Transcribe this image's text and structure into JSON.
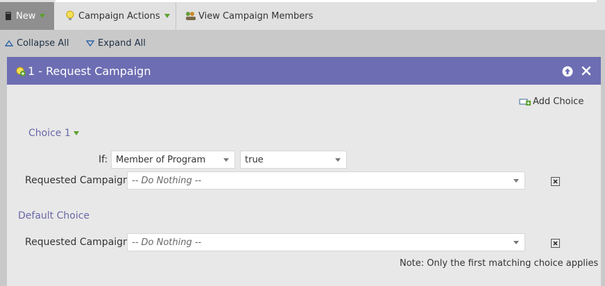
{
  "toolbar": {
    "new_label": "New",
    "campaign_actions_label": "Campaign Actions",
    "view_members_label": "View Campaign Members"
  },
  "subbar": {
    "collapse_all": "Collapse All",
    "expand_all": "Expand All"
  },
  "panel": {
    "title": "1 - Request Campaign",
    "add_choice": "Add Choice",
    "choice1": {
      "label": "Choice 1",
      "if_label": "If:",
      "condition": "Member of Program",
      "value": "true",
      "requested_label": "Requested Campaign:",
      "requested_value": "-- Do Nothing --"
    },
    "default_choice": {
      "label": "Default Choice",
      "requested_label": "Requested Campaign:",
      "requested_value": "-- Do Nothing --"
    },
    "note": "Note: Only the first matching choice applies"
  },
  "colors": {
    "header_bg": "#6d6db3",
    "accent_green": "#59a12c",
    "section_text": "#6b68a8"
  }
}
